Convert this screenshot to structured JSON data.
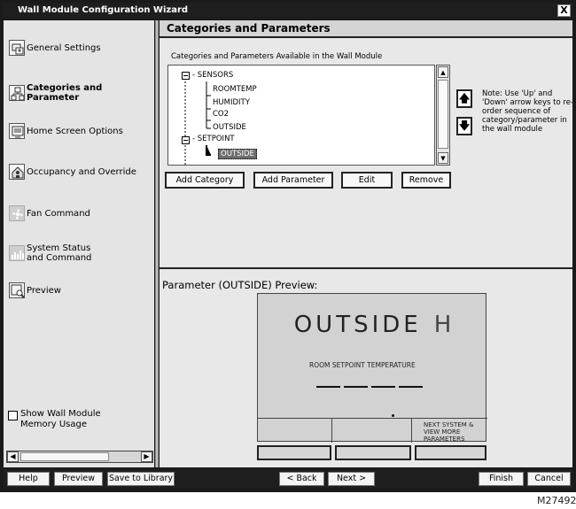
{
  "window": {
    "title": "Wall Module Configuration Wizard",
    "close_glyph": "X"
  },
  "sidebar": {
    "items": [
      {
        "label": "General Settings",
        "icon": "general-settings-icon"
      },
      {
        "label": "Categories and Parameter",
        "icon": "categories-icon"
      },
      {
        "label": "Home Screen Options",
        "icon": "home-screen-icon"
      },
      {
        "label": "Occupancy and Override",
        "icon": "occupancy-icon"
      },
      {
        "label": "Fan Command",
        "icon": "fan-icon"
      },
      {
        "label": "System Status and Command",
        "icon": "system-status-icon"
      },
      {
        "label": "Preview",
        "icon": "preview-icon"
      }
    ],
    "memory_checkbox": {
      "label": "Show Wall Module Memory Usage",
      "checked": false
    }
  },
  "main": {
    "section_title": "Categories and Parameters",
    "tree_caption": "Categories and Parameters Available in the Wall Module",
    "tree": {
      "categories": [
        {
          "name": "SENSORS",
          "params": [
            "ROOMTEMP",
            "HUMIDITY",
            "CO2",
            "OUTSIDE"
          ]
        },
        {
          "name": "SETPOINT",
          "params": [
            "OUTSIDE"
          ]
        }
      ],
      "selected": "OUTSIDE"
    },
    "move_up_glyph": "🡅",
    "move_down_glyph": "🡇",
    "note": "Note: Use 'Up' and 'Down' arrow keys to re-order sequence of category/parameter in the wall module",
    "actions": [
      "Add Category",
      "Add Parameter",
      "Edit",
      "Remove"
    ],
    "preview": {
      "label": "Parameter (OUTSIDE) Preview:",
      "big_text": "OUTSIDE",
      "unit": "H",
      "small_text": "ROOM SETPOINT TEMPERATURE",
      "softkey_text": "NEXT SYSTEM & VIEW MORE PARAMETERS"
    }
  },
  "footer": {
    "buttons": [
      "Help",
      "Preview",
      "Save to Library",
      "< Back",
      "Next >",
      "Finish",
      "Cancel"
    ]
  },
  "figure_ref": "M27492"
}
